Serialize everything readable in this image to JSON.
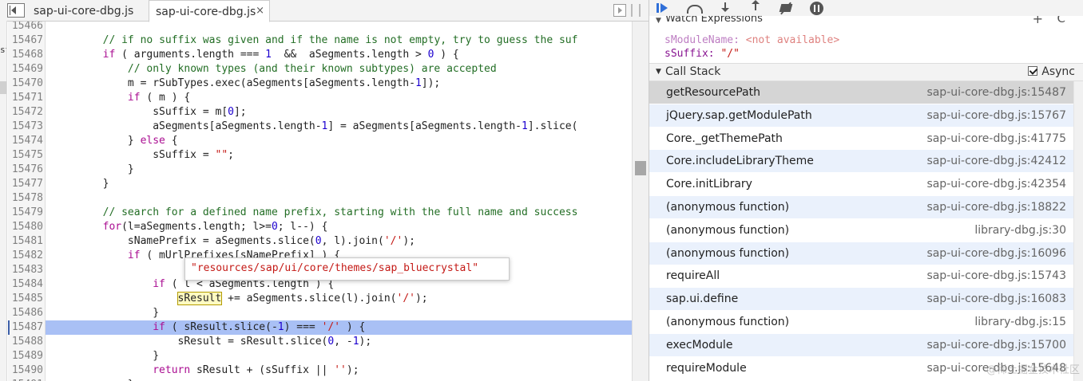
{
  "editor": {
    "tabs": [
      {
        "label": "sap-ui-core-dbg.js"
      },
      {
        "label": "sap-ui-core-dbg.js",
        "close": "×"
      }
    ],
    "left_fragment": "st",
    "lines": [
      {
        "n": "15466",
        "html": ""
      },
      {
        "n": "15467",
        "html": "        <span class='cm'>// if no suffix was given and if the name is not empty, try to guess the suf</span>"
      },
      {
        "n": "15468",
        "html": "        <span class='kw'>if</span> ( arguments.length === <span class='nm'>1</span>  &amp;&amp;  aSegments.length &gt; <span class='nm'>0</span> ) {"
      },
      {
        "n": "15469",
        "html": "            <span class='cm'>// only known types (and their known subtypes) are accepted</span>"
      },
      {
        "n": "15470",
        "html": "            m = rSubTypes.exec(aSegments[aSegments.length-<span class='nm'>1</span>]);"
      },
      {
        "n": "15471",
        "html": "            <span class='kw'>if</span> ( m ) {"
      },
      {
        "n": "15472",
        "html": "                sSuffix = m[<span class='nm'>0</span>];"
      },
      {
        "n": "15473",
        "html": "                aSegments[aSegments.length-<span class='nm'>1</span>] = aSegments[aSegments.length-<span class='nm'>1</span>].slice("
      },
      {
        "n": "15474",
        "html": "            } <span class='kw'>else</span> {"
      },
      {
        "n": "15475",
        "html": "                sSuffix = <span class='st'>\"\"</span>;"
      },
      {
        "n": "15476",
        "html": "            }"
      },
      {
        "n": "15477",
        "html": "        }"
      },
      {
        "n": "15478",
        "html": ""
      },
      {
        "n": "15479",
        "html": "        <span class='cm'>// search for a defined name prefix, starting with the full name and success</span>"
      },
      {
        "n": "15480",
        "html": "        <span class='kw'>for</span>(l=aSegments.length; l&gt;=<span class='nm'>0</span>; l--) {"
      },
      {
        "n": "15481",
        "html": "            sNamePrefix = aSegments.slice(<span class='nm'>0</span>, l).join(<span class='st'>'/'</span>);"
      },
      {
        "n": "15482",
        "html": "            <span class='kw'>if</span> ( mUrlPrefixes[sNamePrefix] ) {"
      },
      {
        "n": "15483",
        "html": ""
      },
      {
        "n": "15484",
        "html": "                <span class='kw'>if</span> ( l &lt; aSegments.length ) {"
      },
      {
        "n": "15485",
        "html": "                    <span class='hl'>sResult</span> += aSegments.slice(l).join(<span class='st'>'/'</span>);"
      },
      {
        "n": "15486",
        "html": "                }"
      },
      {
        "n": "15487",
        "html": "                <span class='kw'>if</span> ( sResult.slice(-<span class='nm'>1</span>) === <span class='st'>'/'</span> ) {"
      },
      {
        "n": "15488",
        "html": "                    sResult = sResult.slice(<span class='nm'>0</span>, -<span class='nm'>1</span>);"
      },
      {
        "n": "15489",
        "html": "                }"
      },
      {
        "n": "15490",
        "html": "                <span class='kw'>return</span> sResult + (sSuffix || <span class='st'>''</span>);"
      },
      {
        "n": "15491",
        "html": "            }"
      }
    ],
    "active_line": "15487",
    "tooltip": "\"resources/sap/ui/core/themes/sap_bluecrystal\""
  },
  "watch": {
    "title": "Watch Expressions",
    "add_icon": "+",
    "refresh_icon": "C",
    "items": [
      {
        "name": "sModuleName:",
        "value": " <not available>"
      },
      {
        "name": "sSuffix:",
        "value": " \"/\""
      }
    ]
  },
  "callstack": {
    "title": "Call Stack",
    "async_label": "Async",
    "frames": [
      {
        "fn": "getResourcePath",
        "loc": "sap-ui-core-dbg.js:15487"
      },
      {
        "fn": "jQuery.sap.getModulePath",
        "loc": "sap-ui-core-dbg.js:15767"
      },
      {
        "fn": "Core._getThemePath",
        "loc": "sap-ui-core-dbg.js:41775"
      },
      {
        "fn": "Core.includeLibraryTheme",
        "loc": "sap-ui-core-dbg.js:42412"
      },
      {
        "fn": "Core.initLibrary",
        "loc": "sap-ui-core-dbg.js:42354"
      },
      {
        "fn": "(anonymous function)",
        "loc": "sap-ui-core-dbg.js:18822"
      },
      {
        "fn": "(anonymous function)",
        "loc": "library-dbg.js:30"
      },
      {
        "fn": "(anonymous function)",
        "loc": "sap-ui-core-dbg.js:16096"
      },
      {
        "fn": "requireAll",
        "loc": "sap-ui-core-dbg.js:15743"
      },
      {
        "fn": "sap.ui.define",
        "loc": "sap-ui-core-dbg.js:16083"
      },
      {
        "fn": "(anonymous function)",
        "loc": "library-dbg.js:15"
      },
      {
        "fn": "execModule",
        "loc": "sap-ui-core-dbg.js:15700"
      },
      {
        "fn": "requireModule",
        "loc": "sap-ui-core-dbg.js:15648"
      }
    ]
  },
  "watermark": "@稀土掘金技术社区",
  "icons": {
    "navigator": "navigator-toggle-icon",
    "resume": "resume-icon",
    "step_over": "step-over-icon",
    "step_into": "step-into-icon",
    "step_out": "step-out-icon",
    "deactivate": "deactivate-breakpoints-icon",
    "pause": "pause-on-exceptions-icon"
  },
  "colors": {
    "active_line": "#a9c0f5",
    "keyword": "#aa0d91",
    "comment": "#236e25",
    "string": "#c41a16",
    "number": "#1c00cf",
    "selected_frame": "#d5d5d5",
    "alt_frame": "#eaf1fc",
    "resume_blue": "#2f6fd8"
  }
}
